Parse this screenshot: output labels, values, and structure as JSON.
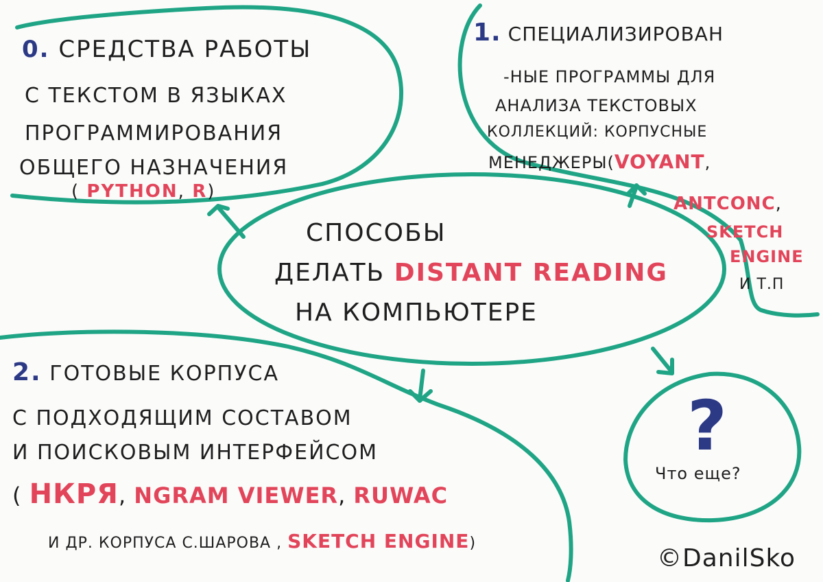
{
  "center": {
    "line1": "СПОСОБЫ",
    "line2a": "ДЕЛАТЬ",
    "line2b": "DISTANT READING",
    "line3": "НА КОМПЬЮТЕРЕ"
  },
  "node0": {
    "number": "0.",
    "line1": "Средства работы",
    "line2": "с текстом в языках",
    "line3": "программирования",
    "line4": "общего назначения",
    "tools_open": "(",
    "tool1": "Python",
    "sep": ",",
    "tool2": "R",
    "tools_close": ")"
  },
  "node1": {
    "number": "1.",
    "line1": "Специализирован",
    "line2": "-ные программы для",
    "line3": "анализа текстовых",
    "line4": "коллекций: корпусные",
    "line5a": "менеджеры",
    "line5b": "(",
    "tool1": "Voyant",
    "tool2": "AntConc",
    "tool3a": "Sketch",
    "tool3b": "Engine",
    "etc": "и т.п",
    "comma": ","
  },
  "node2": {
    "number": "2.",
    "line1": "Готовые корпуса",
    "line2": "с подходящим составом",
    "line3": "и поисковым интерфейсом",
    "open": "(",
    "tool1": "НКРЯ",
    "tool2": "Ngram Viewer",
    "tool3": "RuWac",
    "comma": ",",
    "line5a": "и др. корпуса С.Шарова ,",
    "tool4": "Sketch Engine",
    "close": ")"
  },
  "node3": {
    "symbol": "?",
    "label": "Что еще?"
  },
  "signature": "©DanilSko",
  "colors": {
    "outline": "#1fa585",
    "text": "#1e1e1e",
    "number": "#2c3a86",
    "highlight": "#e2455a"
  }
}
